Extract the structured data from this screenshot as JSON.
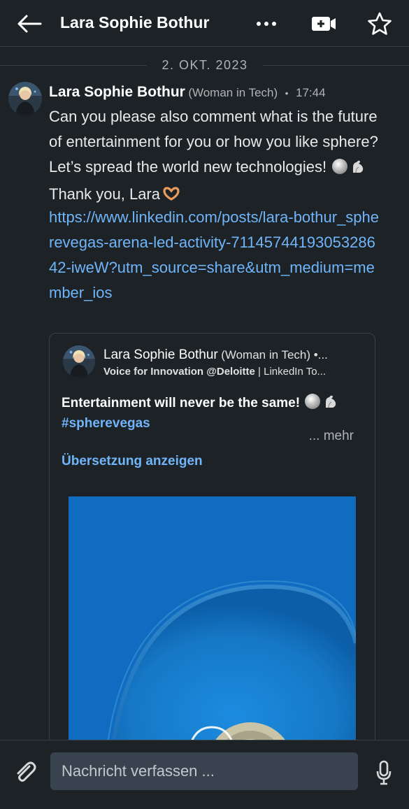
{
  "header": {
    "title": "Lara Sophie Bothur",
    "icons": {
      "back": "back-arrow-icon",
      "more": "more-dots-icon",
      "video": "video-call-icon",
      "star": "star-icon"
    }
  },
  "date_divider": "2. OKT. 2023",
  "message": {
    "sender_name": "Lara Sophie Bothur",
    "sender_headline": "(Woman in Tech)",
    "separator": "•",
    "time": "17:44",
    "text_part1": " Can you please also comment what is the future of entertainment for you or how you like sphere? Let’s spread the world new technologies!",
    "text_part2": " Thank you, Lara",
    "link": "https://www.linkedin.com/posts/lara-bothur_spherevegas-arena-led-activity-7114574419305328642-iweW?utm_source=share&utm_medium=member_ios"
  },
  "shared_post": {
    "author_name": "Lara Sophie Bothur",
    "author_headline": "(Woman in Tech) •...",
    "subtitle_bold": "Voice for Innovation @Deloitte",
    "subtitle_rest": " | LinkedIn To...",
    "text": "Entertainment will never be the same!",
    "hashtag": "#spherevegas",
    "more_label": "... mehr",
    "translate_label": "Übersetzung anzeigen"
  },
  "composer": {
    "placeholder": "Nachricht verfassen ...",
    "icons": {
      "attach": "paperclip-icon",
      "mic": "microphone-icon"
    }
  },
  "colors": {
    "background": "#1d2226",
    "link": "#70b5f9",
    "input_bg": "#38434f",
    "divider": "#3a3f44"
  }
}
